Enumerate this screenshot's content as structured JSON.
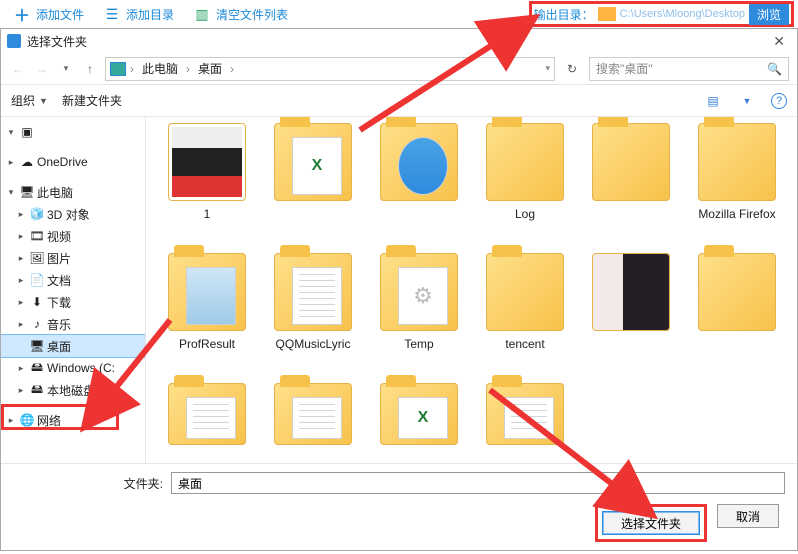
{
  "toolbar": {
    "add_file": "添加文件",
    "add_dir": "添加目录",
    "clear_list": "清空文件列表",
    "output_label": "输出目录：",
    "output_path": "C:\\Users\\Mloong\\Desktop",
    "browse": "浏览"
  },
  "dialog": {
    "title": "选择文件夹",
    "close_glyph": "✕"
  },
  "nav": {
    "back": "←",
    "fwd": "→",
    "up": "↑",
    "crumbs": [
      "此电脑",
      "桌面"
    ],
    "sep": "›",
    "refresh": "↻",
    "search_placeholder": "搜索\"桌面\"",
    "search_icon": "🔍"
  },
  "cmd": {
    "organize": "组织",
    "new_folder": "新建文件夹"
  },
  "tree": [
    {
      "label": "",
      "icon": "quick",
      "ind": 0,
      "tw": "v",
      "blur": true
    },
    {
      "label": "OneDrive",
      "icon": "cloud",
      "ind": 0,
      "tw": ">"
    },
    {
      "label": "此电脑",
      "icon": "pc",
      "ind": 0,
      "tw": "v"
    },
    {
      "label": "3D 对象",
      "icon": "3d",
      "ind": 1,
      "tw": ">"
    },
    {
      "label": "视频",
      "icon": "video",
      "ind": 1,
      "tw": ">"
    },
    {
      "label": "图片",
      "icon": "pic",
      "ind": 1,
      "tw": ">"
    },
    {
      "label": "文档",
      "icon": "doc",
      "ind": 1,
      "tw": ">"
    },
    {
      "label": "下载",
      "icon": "dl",
      "ind": 1,
      "tw": ">"
    },
    {
      "label": "音乐",
      "icon": "music",
      "ind": 1,
      "tw": ">"
    },
    {
      "label": "桌面",
      "icon": "desk",
      "ind": 1,
      "tw": "",
      "sel": true
    },
    {
      "label": "Windows (C:",
      "icon": "drive",
      "ind": 1,
      "tw": ">"
    },
    {
      "label": "本地磁盘 (D:",
      "icon": "drive",
      "ind": 1,
      "tw": ">"
    },
    {
      "label": "网络",
      "icon": "net",
      "ind": 0,
      "tw": ">"
    }
  ],
  "items": [
    {
      "label": "1",
      "kind": "img1"
    },
    {
      "label": "",
      "kind": "xlsx",
      "blur": true
    },
    {
      "label": "",
      "kind": "ad",
      "blur": true
    },
    {
      "label": "Log",
      "kind": "folder"
    },
    {
      "label": "",
      "kind": "folder",
      "blur": true
    },
    {
      "label": "Mozilla Firefox",
      "kind": "folder"
    },
    {
      "label": "ProfResult",
      "kind": "notepad"
    },
    {
      "label": "QQMusicLyric",
      "kind": "lines"
    },
    {
      "label": "Temp",
      "kind": "gear"
    },
    {
      "label": "tencent",
      "kind": "folder"
    },
    {
      "label": "",
      "kind": "photo",
      "blur": true
    },
    {
      "label": "",
      "kind": "folder",
      "blur": true
    },
    {
      "label": "",
      "kind": "lines",
      "blur": true,
      "short": true
    },
    {
      "label": "",
      "kind": "lines",
      "blur": true,
      "short": true
    },
    {
      "label": "",
      "kind": "xlsx",
      "blur": true,
      "short": true
    },
    {
      "label": "",
      "kind": "lines",
      "blur": true,
      "short": true
    }
  ],
  "bottom": {
    "folder_label": "文件夹:",
    "folder_value": "桌面",
    "select": "选择文件夹",
    "cancel": "取消"
  },
  "icons": {
    "cloud": "☁",
    "pc": "🖥",
    "3d": "🧊",
    "video": "🎞",
    "pic": "🖼",
    "doc": "📄",
    "dl": "⬇",
    "music": "♪",
    "desk": "🖥",
    "drive": "🖴",
    "net": "🌐"
  }
}
